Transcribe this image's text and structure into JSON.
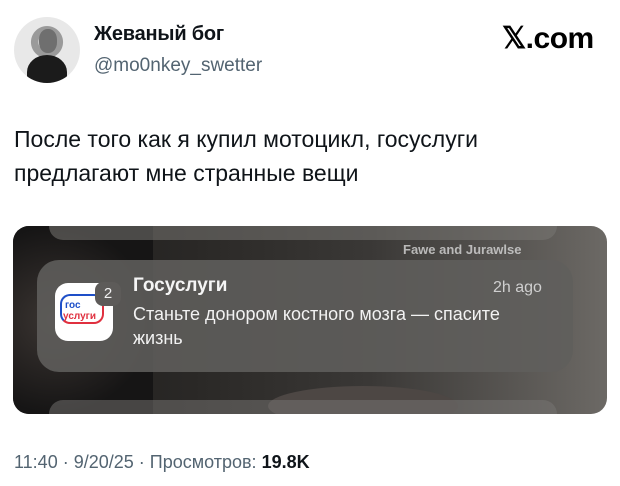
{
  "author": {
    "display_name": "Жеваный бог",
    "handle": "@mo0nkey_swetter"
  },
  "brand": {
    "label": "𝕏.com"
  },
  "tweet": {
    "text": "После того как я купил мотоцикл, госуслуги предлагают мне странные вещи"
  },
  "screenshot": {
    "background_text": "Fawe and Jurawlse",
    "notification": {
      "app_name": "Госуслуги",
      "time": "2h ago",
      "badge": "2",
      "body": "Станьте донором костного мозга — спасите жизнь",
      "icon_line1": "гос",
      "icon_line2": "услуги"
    }
  },
  "meta": {
    "time": "11:40",
    "separator1": " · ",
    "date": "9/20/25",
    "separator2": " · ",
    "views_label": "Просмотров: ",
    "views_count": "19.8K"
  },
  "colors": {
    "text": "#0f1419",
    "secondary": "#536471",
    "gosuslugi_blue": "#1e4fc8",
    "gosuslugi_red": "#e0303f"
  }
}
